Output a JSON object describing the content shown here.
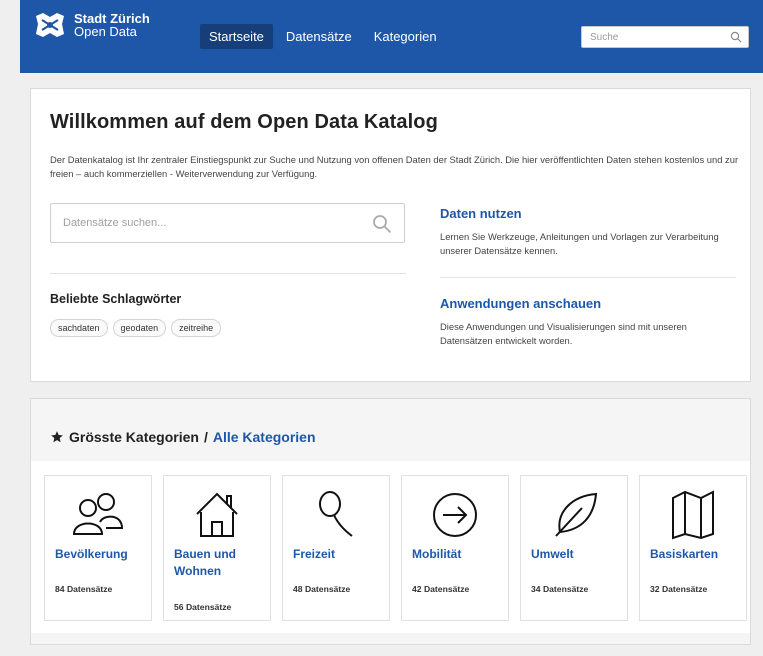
{
  "header": {
    "brand_line1": "Stadt Zürich",
    "brand_line2": "Open Data",
    "nav": [
      {
        "label": "Startseite",
        "active": true
      },
      {
        "label": "Datensätze",
        "active": false
      },
      {
        "label": "Kategorien",
        "active": false
      }
    ],
    "search_placeholder": "Suche",
    "bar_color": "#1f57a8"
  },
  "welcome": {
    "title": "Willkommen auf dem Open Data Katalog",
    "intro": "Der Datenkatalog ist Ihr zentraler Einstiegspunkt zur Suche und Nutzung von offenen Daten der Stadt Zürich. Die hier veröffentlichten Daten stehen kostenlos und zur freien – auch kommerziellen - Weiterverwendung zur Verfügung.",
    "search_placeholder": "Datensätze suchen...",
    "tags_title": "Beliebte Schlagwörter",
    "tags": [
      "sachdaten",
      "geodaten",
      "zeitreihe"
    ],
    "use_title": "Daten nutzen",
    "use_desc": "Lernen Sie Werkzeuge, Anleitungen und Vorlagen zur Verarbeitung unserer Datensätze kennen.",
    "apps_title": "Anwendungen anschauen",
    "apps_desc": "Diese Anwendungen und Visualisierungen sind mit unseren Datensätzen entwickelt worden."
  },
  "categories": {
    "heading": "Grösste Kategorien",
    "separator": "/",
    "all_link": "Alle Kategorien",
    "items": [
      {
        "name": "Bevölkerung",
        "count": "84 Datensätze",
        "icon": "people-icon"
      },
      {
        "name": "Bauen und Wohnen",
        "count": "56 Datensätze",
        "icon": "house-icon"
      },
      {
        "name": "Freizeit",
        "count": "48 Datensätze",
        "icon": "racket-icon"
      },
      {
        "name": "Mobilität",
        "count": "42 Datensätze",
        "icon": "arrow-circle-icon"
      },
      {
        "name": "Umwelt",
        "count": "34 Datensätze",
        "icon": "leaf-icon"
      },
      {
        "name": "Basiskarten",
        "count": "32 Datensätze",
        "icon": "map-icon"
      }
    ]
  }
}
